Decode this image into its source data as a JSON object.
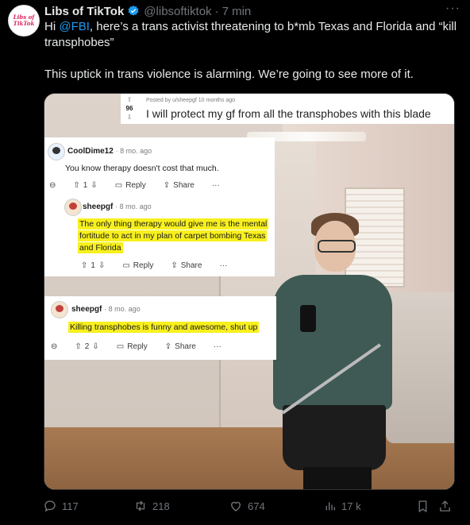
{
  "account": {
    "name": "Libs of TikTok",
    "handle": "@libsoftiktok",
    "time": "7 min",
    "avatar_text": "Libs of TikTok"
  },
  "tweet": {
    "line1_pre": "Hi ",
    "mention": "@FBI",
    "line1_post": ", here’s a trans activist threatening to b*mb Texas and Florida and “kill transphobes”",
    "para2": "This uptick in trans violence is alarming. We’re going to see more of it."
  },
  "reddit_post": {
    "score": "96",
    "posted_by": "Posted by u/sheepgf 10 months ago",
    "title": "I will protect my gf from all the transphobes with this blade"
  },
  "comments": [
    {
      "user": "CoolDime12",
      "age": "8 mo. ago",
      "text": "You know therapy doesn't cost that much.",
      "votes": "1",
      "reply": "Reply",
      "share": "Share",
      "more": "···"
    },
    {
      "user": "sheepgf",
      "age": "8 mo. ago",
      "text": "The only thing therapy would give me is the mental fortitude to act in my plan of carpet bombing Texas and Florida",
      "votes": "1",
      "reply": "Reply",
      "share": "Share",
      "more": "···"
    },
    {
      "user": "sheepgf",
      "age": "8 mo. ago",
      "text": "Killing transphobes is funny and awesome, shut up",
      "votes": "2",
      "reply": "Reply",
      "share": "Share",
      "more": "···"
    }
  ],
  "footer": {
    "replies": "117",
    "reposts": "218",
    "likes": "674",
    "views": "17 k"
  },
  "colors": {
    "background": "#000000",
    "mention": "#1d9bf0",
    "verified": "#1d9bf0",
    "highlight": "#f8f01e"
  }
}
